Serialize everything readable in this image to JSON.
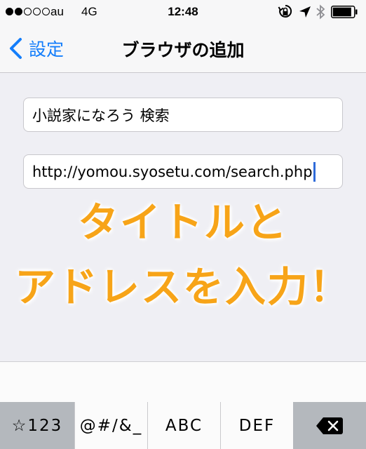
{
  "status_bar": {
    "signal_dots": [
      true,
      true,
      false,
      false,
      false
    ],
    "carrier": "au",
    "network": "4G",
    "time": "12:48",
    "icons": [
      "rotation-lock-icon",
      "location-arrow-icon",
      "bluetooth-icon",
      "battery-icon"
    ],
    "battery_level": 0.9
  },
  "nav": {
    "back_label": "設定",
    "title": "ブラウザの追加",
    "accent_color": "#147efb"
  },
  "form": {
    "title_value": "小説家になろう 検索",
    "url_value": "http://yomou.syosetu.com/search.php"
  },
  "overlay": {
    "line1": "タイトルと",
    "line2": "アドレスを入力！",
    "color": "#f7a418"
  },
  "keyboard": {
    "keys": [
      "☆123",
      "@#/&_",
      "ABC",
      "DEF"
    ],
    "delete_icon": "delete-backspace-icon"
  }
}
